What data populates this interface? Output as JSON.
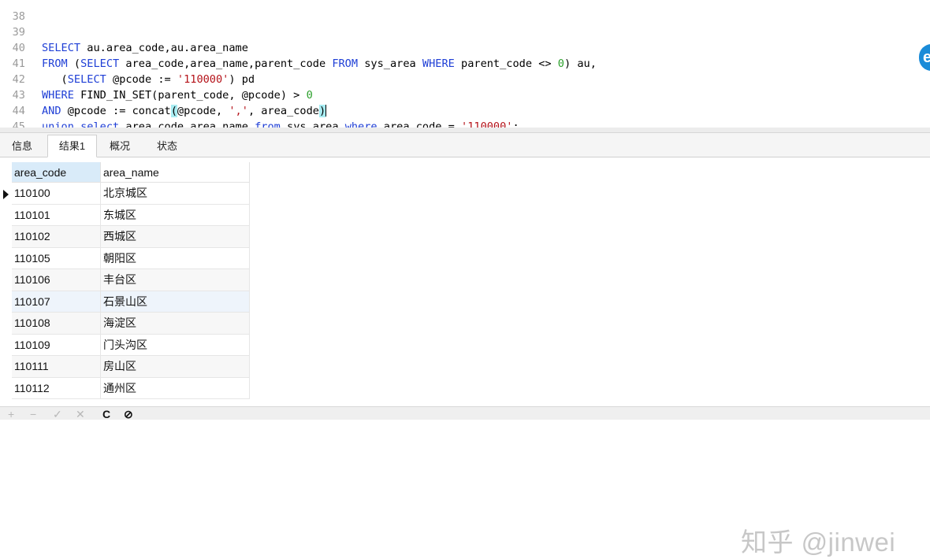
{
  "editor": {
    "lines": [
      {
        "num": "38"
      },
      {
        "num": "39"
      },
      {
        "num": "40"
      },
      {
        "num": "41"
      },
      {
        "num": "42"
      },
      {
        "num": "43"
      },
      {
        "num": "44"
      },
      {
        "num": "45"
      }
    ],
    "code": {
      "l39": {
        "kw1": "SELECT",
        "t1": " au.area_code,au.area_name"
      },
      "l40": {
        "kw1": "FROM",
        "t1": " (",
        "kw2": "SELECT",
        "t2": " area_code,area_name,parent_code ",
        "kw3": "FROM",
        "t3": " sys_area ",
        "kw4": "WHERE",
        "t4": " parent_code <> ",
        "n1": "0",
        "t5": ") au,"
      },
      "l41": {
        "t0": "   (",
        "kw1": "SELECT",
        "t1": " @pcode := ",
        "s1": "'110000'",
        "t2": ") pd"
      },
      "l42": {
        "kw1": "WHERE",
        "t1": " FIND_IN_SET(parent_code, @pcode) > ",
        "n1": "0"
      },
      "l43": {
        "kw1": "AND",
        "t1": " @pcode := concat",
        "p1": "(",
        "t2": "@pcode, ",
        "s1": "','",
        "t3": ", area_code",
        "p2": ")"
      },
      "l44": {
        "kw1": "union select",
        "t1": " area_code,area_name ",
        "kw2": "from",
        "t2": " sys_area ",
        "kw3": "where",
        "t3": " area_code = ",
        "s1": "'110000'",
        "t4": ";"
      }
    },
    "float_button_icon": "e"
  },
  "tabs": [
    {
      "label": "信息"
    },
    {
      "label": "结果1"
    },
    {
      "label": "概况"
    },
    {
      "label": "状态"
    }
  ],
  "results": {
    "columns": [
      "area_code",
      "area_name"
    ],
    "rows": [
      [
        "110100",
        "北京城区"
      ],
      [
        "110101",
        "东城区"
      ],
      [
        "110102",
        "西城区"
      ],
      [
        "110105",
        "朝阳区"
      ],
      [
        "110106",
        "丰台区"
      ],
      [
        "110107",
        "石景山区"
      ],
      [
        "110108",
        "海淀区"
      ],
      [
        "110109",
        "门头沟区"
      ],
      [
        "110111",
        "房山区"
      ],
      [
        "110112",
        "通州区"
      ]
    ]
  },
  "watermark": "知乎 @jinwei",
  "toolbar": {
    "add": "+",
    "remove": "−",
    "apply": "✓",
    "discard": "✕",
    "refresh": "C",
    "stop": "⊘"
  },
  "colors": {
    "keyword": "#1f3fd6",
    "string": "#b5131a",
    "number": "#2ca02c",
    "bracket_highlight": "#a8ecf2",
    "selected_header": "#d9ebf9"
  }
}
